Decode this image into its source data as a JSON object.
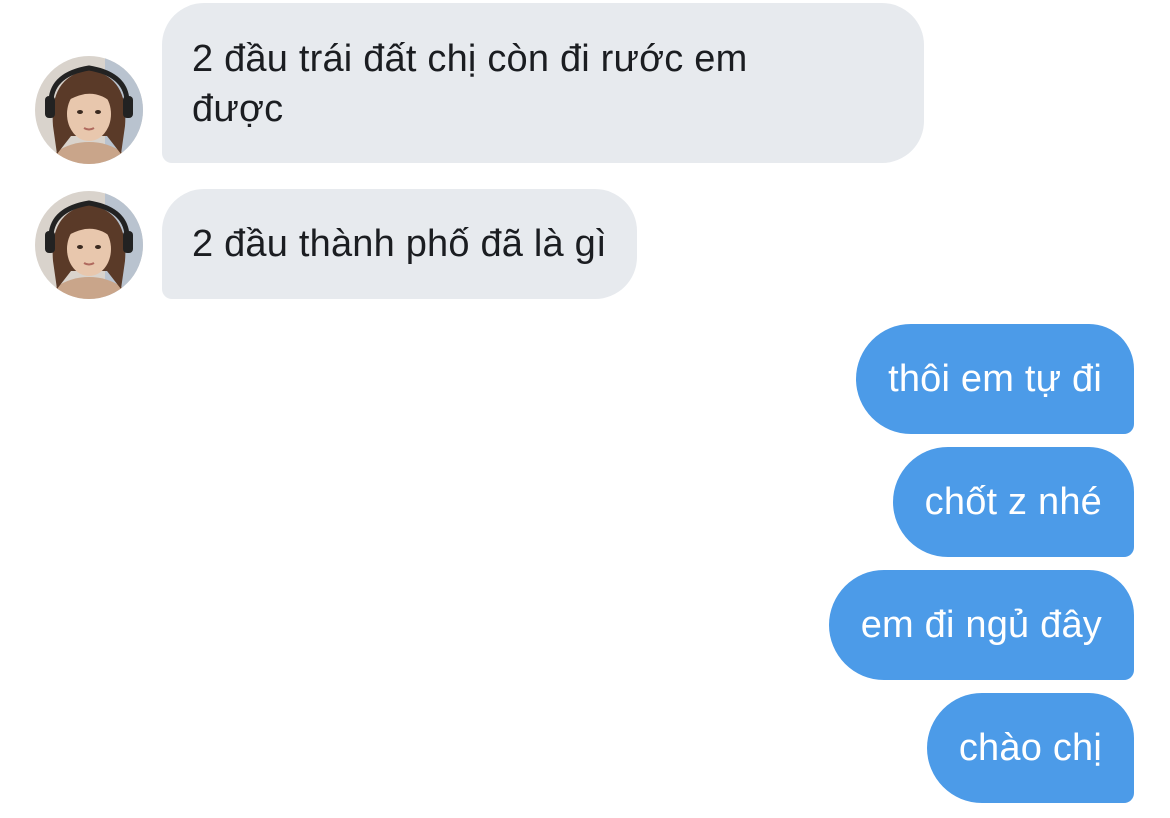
{
  "conversation": {
    "messages": [
      {
        "direction": "incoming",
        "text": "2 đầu trái đất chị còn đi rước em\nđược"
      },
      {
        "direction": "incoming",
        "text": "2 đầu thành phố đã là gì"
      },
      {
        "direction": "outgoing",
        "text": "thôi em tự đi"
      },
      {
        "direction": "outgoing",
        "text": "chốt z nhé"
      },
      {
        "direction": "outgoing",
        "text": "em đi ngủ đây"
      },
      {
        "direction": "outgoing",
        "text": "chào chị"
      }
    ]
  },
  "colors": {
    "incoming_bubble": "#e7eaee",
    "outgoing_bubble": "#4c9be8",
    "incoming_text": "#1b1d21",
    "outgoing_text": "#ffffff"
  },
  "icons": {
    "avatar": "contact-avatar-photo"
  }
}
